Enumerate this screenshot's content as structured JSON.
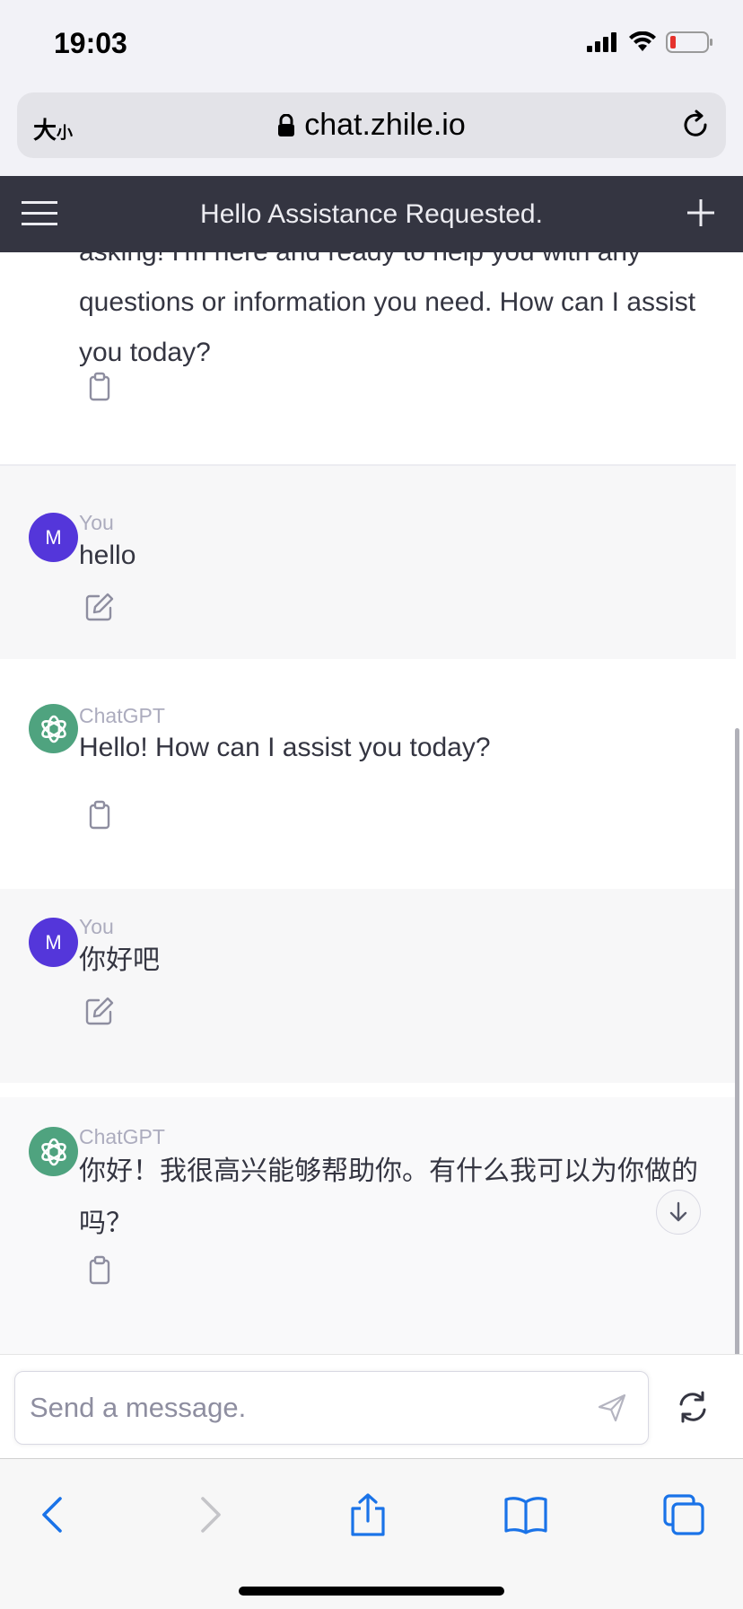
{
  "status_bar": {
    "time": "19:03"
  },
  "browser": {
    "text_size_label": "大",
    "text_size_small": "小",
    "url": "chat.zhile.io"
  },
  "chat": {
    "title": "Hello Assistance Requested.",
    "messages": [
      {
        "role": "assistant",
        "author": "ChatGPT",
        "text": "asking! I'm here and ready to help you with any questions or information you need. How can I assist you today?"
      },
      {
        "role": "user",
        "author": "You",
        "avatar_letter": "M",
        "text": "hello"
      },
      {
        "role": "assistant",
        "author": "ChatGPT",
        "text": "Hello! How can I assist you today?"
      },
      {
        "role": "user",
        "author": "You",
        "avatar_letter": "M",
        "text": "你好吧"
      },
      {
        "role": "assistant",
        "author": "ChatGPT",
        "text": "你好！我很高兴能够帮助你。有什么我可以为你做的吗？"
      }
    ]
  },
  "input": {
    "placeholder": "Send a message."
  },
  "colors": {
    "header_bg": "#343541",
    "user_avatar": "#5436da",
    "gpt_avatar": "#4fa37f",
    "safari_blue": "#1a73e8"
  },
  "icons": [
    "signal-icon",
    "wifi-icon",
    "battery-icon",
    "lock-icon",
    "reload-icon",
    "menu-icon",
    "plus-icon",
    "clipboard-icon",
    "edit-icon",
    "openai-logo-icon",
    "arrow-down-icon",
    "send-icon",
    "regenerate-icon",
    "back-icon",
    "forward-icon",
    "share-icon",
    "bookmarks-icon",
    "tabs-icon"
  ]
}
